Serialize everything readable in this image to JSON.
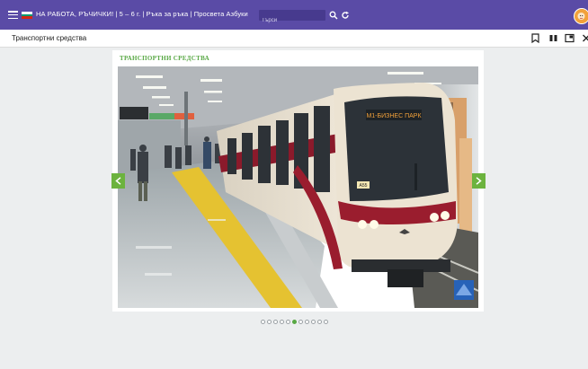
{
  "header": {
    "app_title": "НА РАБОТА, РЪЧИЧКИ! | 5 – 6 г. | Ръка за ръка | Просвета Азбуки",
    "search_placeholder": "Търси",
    "bg_color": "#5a4ba6"
  },
  "subbar": {
    "section_title": "Транспортни средства"
  },
  "content": {
    "heading": "ТРАНСПОРТНИ СРЕДСТВА",
    "heading_color": "#58a844",
    "train_sign": "М1-БИЗНЕС ПАРК",
    "train_number": "А55"
  },
  "carousel": {
    "total": 11,
    "active": 6
  }
}
